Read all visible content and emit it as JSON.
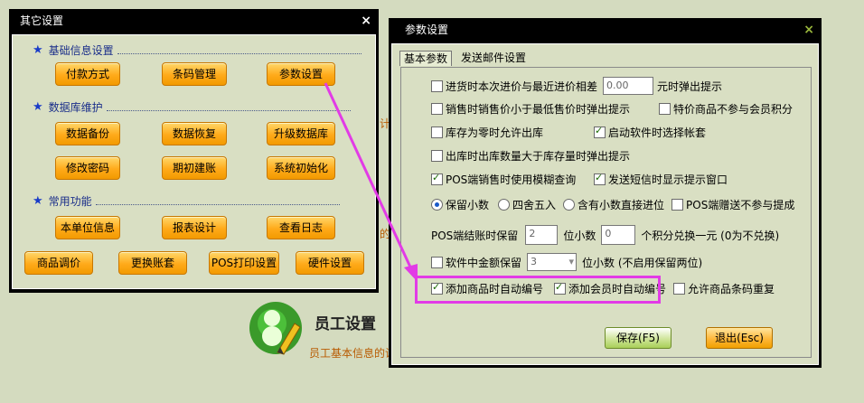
{
  "background": {
    "employee_title": "员工设置",
    "employee_desc": "员工基本信息的设"
  },
  "other_window": {
    "title": "其它设置",
    "close": "×",
    "section_basic": "基础信息设置",
    "section_db": "数据库维护",
    "section_common": "常用功能",
    "buttons": {
      "payment": "付款方式",
      "barcode": "条码管理",
      "params": "参数设置",
      "backup": "数据备份",
      "restore": "数据恢复",
      "upgrade": "升级数据库",
      "change_pwd": "修改密码",
      "opening": "期初建账",
      "init": "系统初始化",
      "unit_info": "本单位信息",
      "report_design": "报表设计",
      "view_log": "查看日志",
      "price_adj": "商品调价",
      "switch_book": "更换账套",
      "pos_print": "POS打印设置",
      "hardware": "硬件设置"
    }
  },
  "param_window": {
    "title": "参数设置",
    "close": "×",
    "tabs": [
      "基本参数",
      "发送邮件设置"
    ],
    "opt_purchase_diff": "进货时本次进价与最近进价相差",
    "purchase_diff_value": "0.00",
    "opt_purchase_diff_suffix": "元时弹出提示",
    "opt_sale_below_min": "销售时销售价小于最低售价时弹出提示",
    "opt_special_no_points": "特价商品不参与会员积分",
    "opt_zero_stock": "库存为零时允许出库",
    "opt_choose_account": "启动软件时选择帐套",
    "opt_out_exceed": "出库时出库数量大于库存量时弹出提示",
    "opt_pos_fuzzy": "POS端销售时使用模糊查询",
    "opt_sms_prompt": "发送短信时显示提示窗口",
    "radio_keep": "保留小数",
    "radio_round": "四舍五入",
    "radio_carry": "含有小数直接进位",
    "opt_pos_gift": "POS端赠送不参与提成",
    "pos_settle_prefix": "POS端结账时保留",
    "pos_settle_value": "2",
    "pos_settle_mid": "位小数",
    "points_value": "0",
    "points_suffix": "个积分兑换一元 (0为不兑换)",
    "opt_amount_keep": "软件中金额保留",
    "amount_keep_value": "3",
    "amount_keep_suffix": "位小数 (不启用保留两位)",
    "opt_auto_goods_no": "添加商品时自动编号",
    "opt_auto_member_no": "添加会员时自动编号",
    "opt_allow_dup_barcode": "允许商品条码重复",
    "save_button": "保存(F5)",
    "exit_button": "退出(Esc)"
  },
  "colors": {
    "highlight": "#e23be6",
    "window_bg": "#d9dfc3"
  }
}
